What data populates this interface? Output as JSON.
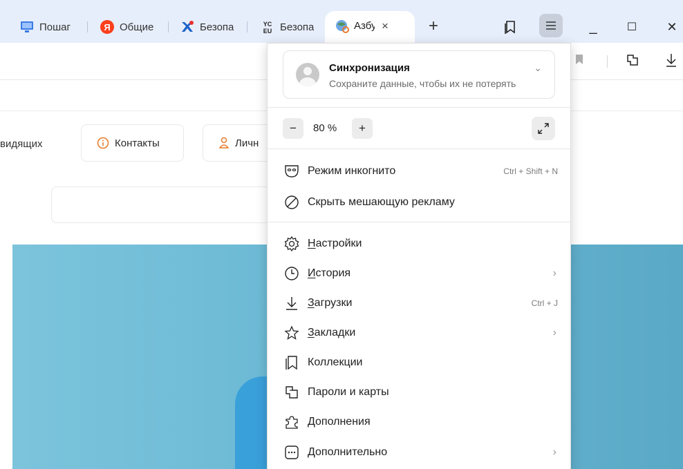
{
  "tabs": [
    {
      "title": "Пошаг",
      "icon": "pc-monitor-icon"
    },
    {
      "title": "Общие",
      "icon": "yandex-icon"
    },
    {
      "title": "Безопа",
      "icon": "puzzle-x-icon"
    },
    {
      "title": "Безопа",
      "icon": "yc-logo-icon"
    }
  ],
  "active_tab": {
    "title": "Азбу",
    "close": "×"
  },
  "new_tab": "+",
  "window": {
    "minimize": "_",
    "maximize": "☐",
    "close": "✕"
  },
  "page": {
    "nav_partial": "видящих",
    "contacts": "Контакты",
    "personal": "Личн"
  },
  "menu": {
    "sync": {
      "title": "Синхронизация",
      "subtitle": "Сохраните данные, чтобы их не потерять",
      "chevron": "⌄"
    },
    "zoom": {
      "minus": "−",
      "value": "80 %",
      "plus": "+"
    },
    "items": [
      {
        "label": "Режим инкогнито",
        "shortcut": "Ctrl + Shift + N"
      },
      {
        "label": "Скрыть мешающую рекламу"
      },
      {
        "first": "Н",
        "rest": "астройки"
      },
      {
        "first": "И",
        "rest": "стория",
        "chevron": "›"
      },
      {
        "first": "З",
        "rest": "агрузки",
        "shortcut": "Ctrl + J"
      },
      {
        "first": "З",
        "rest": "акладки",
        "chevron": "›"
      },
      {
        "label": "Коллекции"
      },
      {
        "label": "Пароли и карты"
      },
      {
        "label": "Дополнения"
      },
      {
        "label": "Дополнительно",
        "chevron": "›"
      }
    ]
  },
  "colors": {
    "tabstrip": "#e7eefb",
    "accent_orange": "#e8792b",
    "hero": "#6ab8d4",
    "menu_button": "#c8cfdb"
  }
}
